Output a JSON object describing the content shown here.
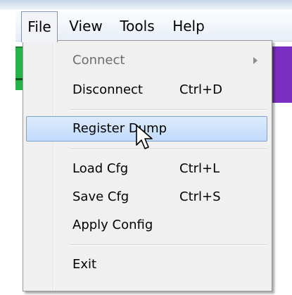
{
  "menubar": {
    "items": [
      {
        "label": "File",
        "active": true
      },
      {
        "label": "View",
        "active": false
      },
      {
        "label": "Tools",
        "active": false
      },
      {
        "label": "Help",
        "active": false
      }
    ]
  },
  "file_menu": {
    "items": [
      {
        "label": "Connect",
        "shortcut": "",
        "enabled": false,
        "has_submenu": true
      },
      {
        "label": "Disconnect",
        "shortcut": "Ctrl+D",
        "enabled": true
      },
      {
        "label": "Register Dump",
        "shortcut": "",
        "enabled": true,
        "highlighted": true
      },
      {
        "label": "Load Cfg",
        "shortcut": "Ctrl+L",
        "enabled": true
      },
      {
        "label": "Save Cfg",
        "shortcut": "Ctrl+S",
        "enabled": true
      },
      {
        "label": "Apply Config",
        "shortcut": "",
        "enabled": true
      },
      {
        "label": "Exit",
        "shortcut": "",
        "enabled": true
      }
    ]
  },
  "icons": {
    "submenu_indicator": "chevron-right-icon",
    "cursor": "mouse-pointer-icon"
  },
  "colors": {
    "highlight_fill": "#c1dbfc",
    "highlight_border": "#7da2ce",
    "disabled_text": "#6d6d6d",
    "menu_background": "#f0f0f0",
    "strip_green": "#26b34a",
    "strip_purple": "#7a2fc0"
  }
}
